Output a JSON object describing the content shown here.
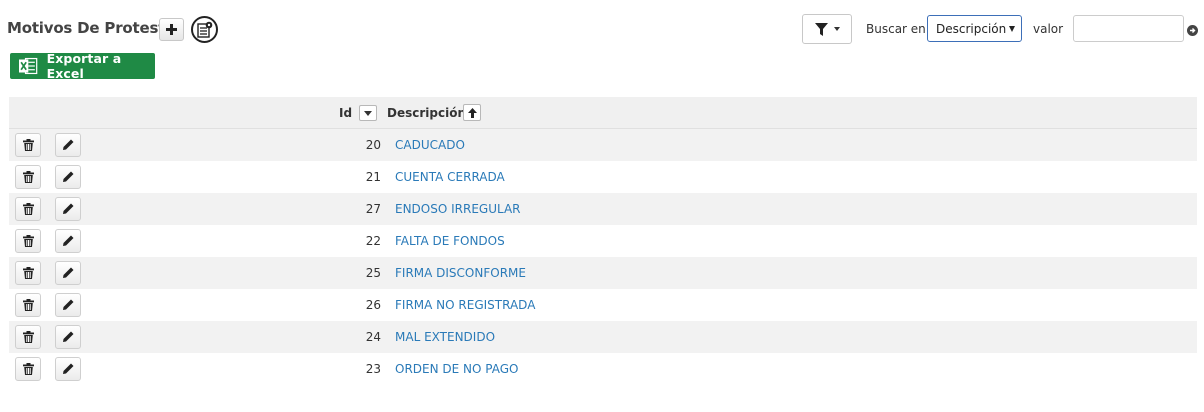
{
  "page": {
    "title": "Motivos De Protesto"
  },
  "toolbar": {
    "excel_label": "Exportar a Excel",
    "buscar_label": "Buscar en",
    "select_value": "Descripción",
    "valor_label": "valor",
    "valor_value": "",
    "excel_color": "#1f8a45"
  },
  "table": {
    "columns": [
      "Id",
      "Descripción"
    ],
    "rows": [
      {
        "id": "20",
        "descripcion": "CADUCADO"
      },
      {
        "id": "21",
        "descripcion": "CUENTA CERRADA"
      },
      {
        "id": "27",
        "descripcion": "ENDOSO IRREGULAR"
      },
      {
        "id": "22",
        "descripcion": "FALTA DE FONDOS"
      },
      {
        "id": "25",
        "descripcion": "FIRMA DISCONFORME"
      },
      {
        "id": "26",
        "descripcion": "FIRMA NO REGISTRADA"
      },
      {
        "id": "24",
        "descripcion": "MAL EXTENDIDO"
      },
      {
        "id": "23",
        "descripcion": "ORDEN DE NO PAGO"
      }
    ],
    "link_color": "#2a7ab8",
    "row_actions": [
      "trash-icon",
      "pencil-icon"
    ],
    "sort": {
      "id": "chevron-down-icon",
      "descripcion": "arrow-up-icon"
    }
  }
}
